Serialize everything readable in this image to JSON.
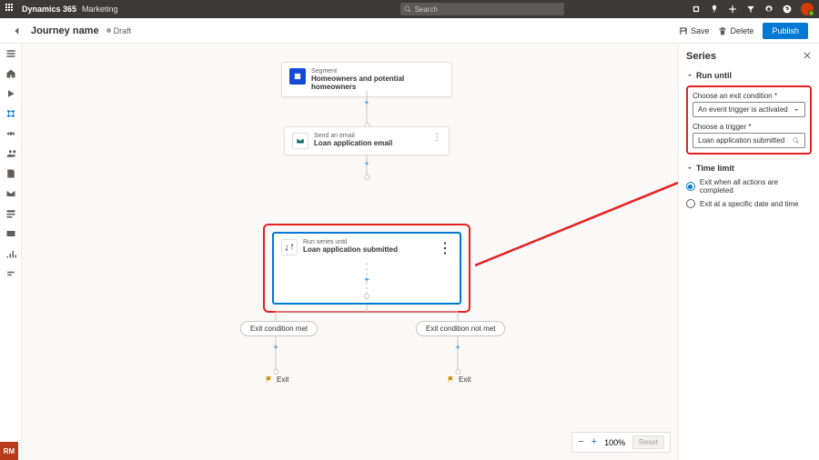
{
  "topbar": {
    "product": "Dynamics 365",
    "module": "Marketing",
    "search_placeholder": "Search"
  },
  "cmdbar": {
    "journey_name": "Journey name",
    "status": "Draft",
    "save": "Save",
    "delete": "Delete",
    "publish": "Publish"
  },
  "nodes": {
    "segment": {
      "subtitle": "Segment",
      "title": "Homeowners and potential homeowners"
    },
    "email": {
      "subtitle": "Send an email",
      "title": "Loan application email"
    },
    "series": {
      "subtitle": "Run series until",
      "title": "Loan application submitted"
    }
  },
  "pills": {
    "met": "Exit condition met",
    "notmet": "Exit condition not met"
  },
  "exit": "Exit",
  "zoom": {
    "level": "100%",
    "reset": "Reset"
  },
  "panel": {
    "title": "Series",
    "section_run_until": "Run until",
    "exit_condition_label": "Choose an exit condition *",
    "exit_condition_value": "An event trigger is activated",
    "trigger_label": "Choose a trigger *",
    "trigger_value": "Loan application submitted",
    "section_time_limit": "Time limit",
    "radio_all": "Exit when all actions are completed",
    "radio_date": "Exit at a specific date and time"
  },
  "badge": "RM"
}
